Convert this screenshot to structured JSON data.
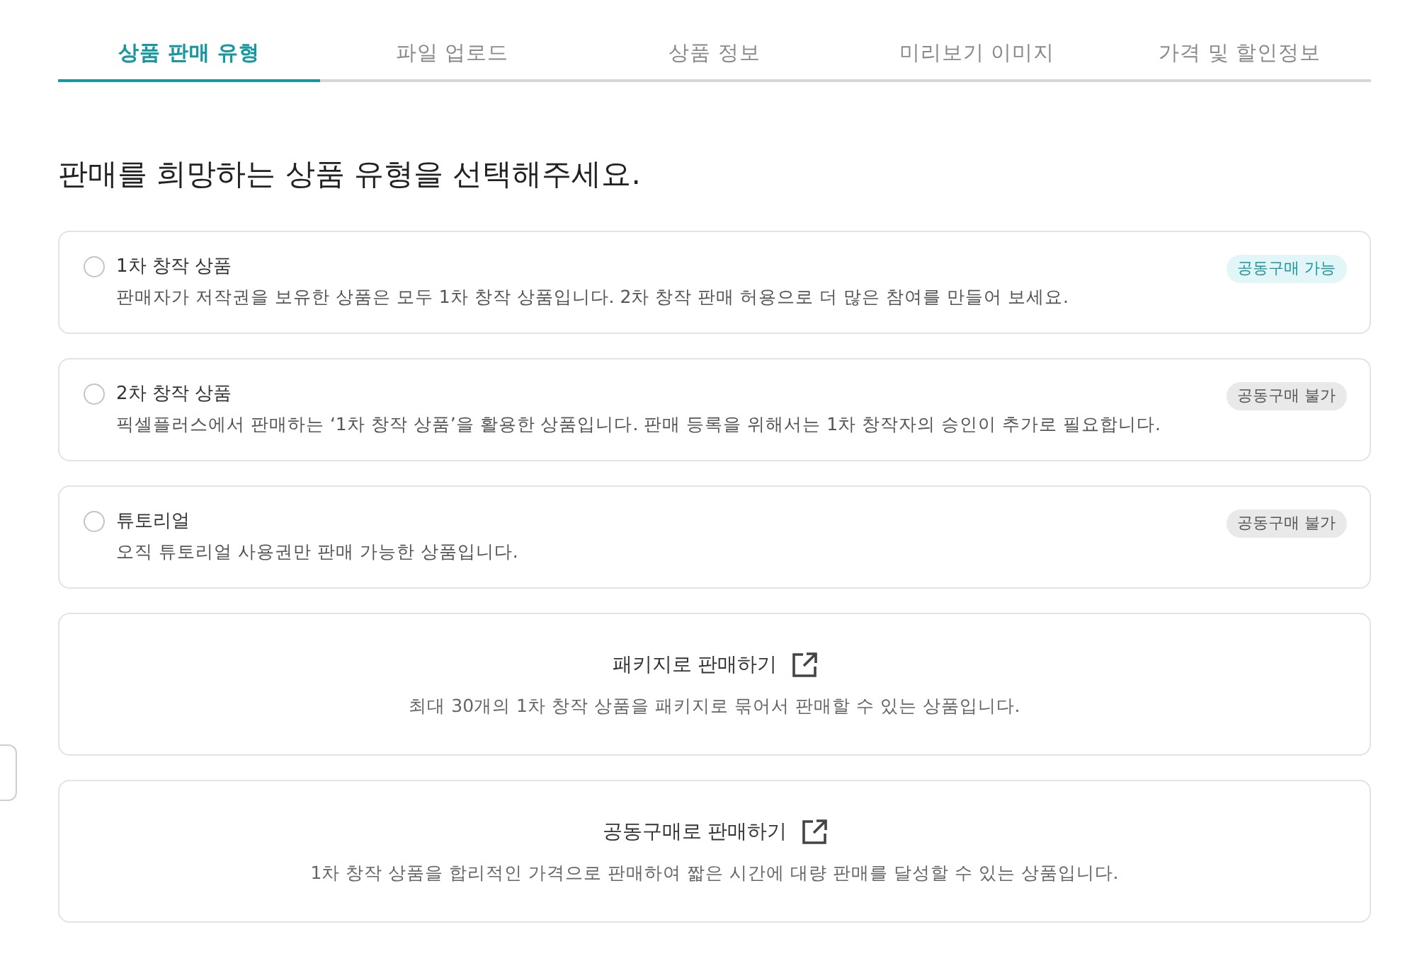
{
  "tabs": [
    {
      "label": "상품 판매 유형",
      "selected": true
    },
    {
      "label": "파일 업로드",
      "selected": false
    },
    {
      "label": "상품 정보",
      "selected": false
    },
    {
      "label": "미리보기 이미지",
      "selected": false
    },
    {
      "label": "가격 및 할인정보",
      "selected": false
    }
  ],
  "heading": "판매를 희망하는 상품 유형을 선택해주세요.",
  "product_types": [
    {
      "title": "1차 창작 상품",
      "description": "판매자가 저작권을 보유한 상품은 모두 1차 창작 상품입니다. 2차 창작 판매 허용으로 더 많은 참여를 만들어 보세요.",
      "selected": false,
      "badge": {
        "label": "공동구매 가능",
        "kind": "available"
      }
    },
    {
      "title": "2차 창작 상품",
      "description": "픽셀플러스에서 판매하는 ‘1차 창작 상품’을 활용한 상품입니다. 판매 등록을 위해서는 1차 창작자의 승인이 추가로 필요합니다.",
      "selected": false,
      "badge": {
        "label": "공동구매 불가",
        "kind": "unavailable"
      }
    },
    {
      "title": "튜토리얼",
      "description": "오직 튜토리얼 사용권만 판매 가능한 상품입니다.",
      "selected": false,
      "badge": {
        "label": "공동구매 불가",
        "kind": "unavailable"
      }
    }
  ],
  "external_options": [
    {
      "title": "패키지로 판매하기",
      "description": "최대 30개의 1차 창작 상품을 패키지로 묶어서 판매할 수 있는 상품입니다."
    },
    {
      "title": "공동구매로 판매하기",
      "description": "1차 창작 상품을 합리적인 가격으로 판매하여 짧은 시간에 대량 판매를 달성할 수 있는 상품입니다."
    }
  ]
}
